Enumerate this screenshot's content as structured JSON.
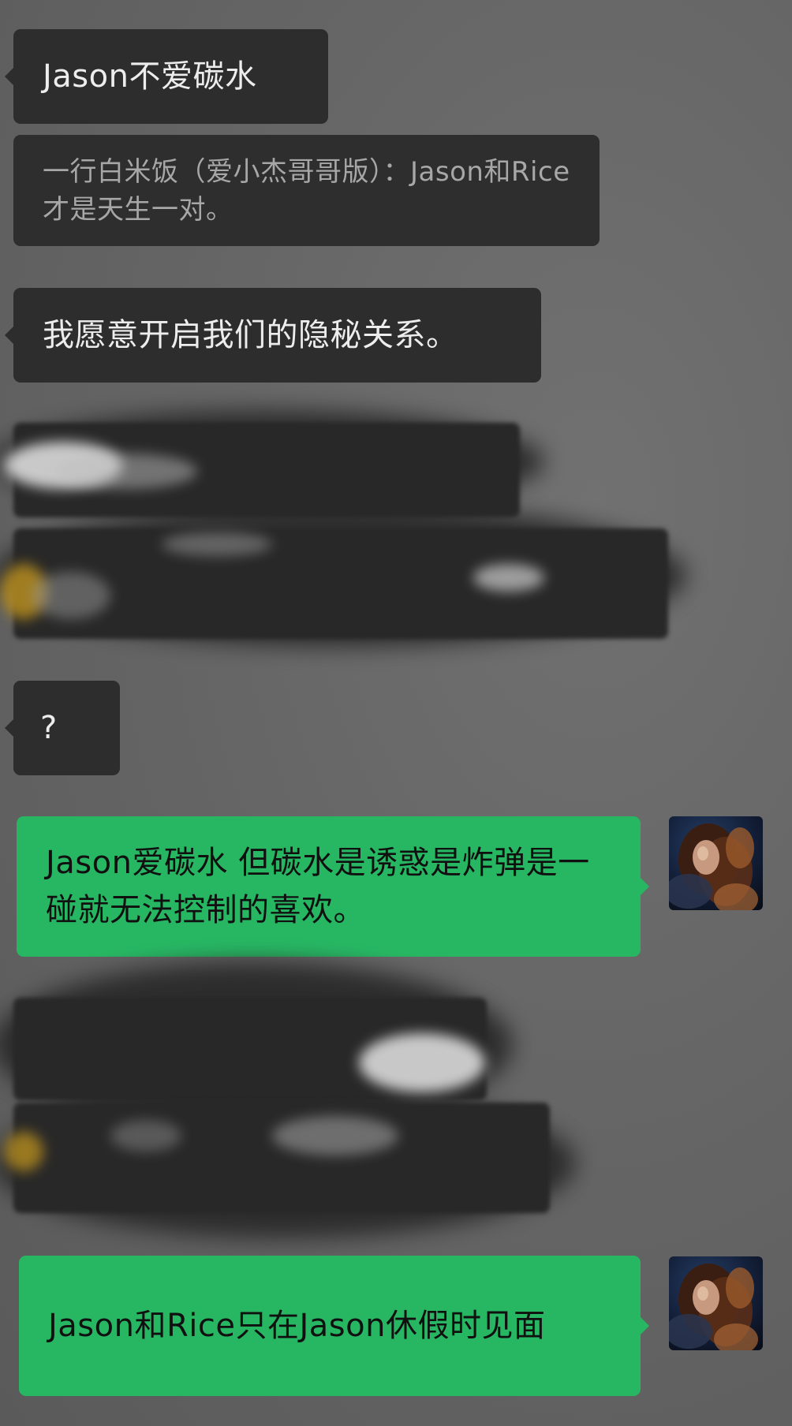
{
  "messages": {
    "m1": "Jason不爱碳水",
    "m2_quote": "一行白米饭（爱小杰哥哥版）：Jason和Rice才是天生一对。",
    "m3": "我愿意开启我们的隐秘关系。",
    "m4": "?",
    "m5": "Jason爱碳水 但碳水是诱惑是炸弹是一碰就无法控制的喜欢。",
    "m6": "Jason和Rice只在Jason休假时见面"
  },
  "colors": {
    "incoming_bubble": "#2d2d2d",
    "outgoing_bubble": "#27b763",
    "background": "#666666"
  }
}
